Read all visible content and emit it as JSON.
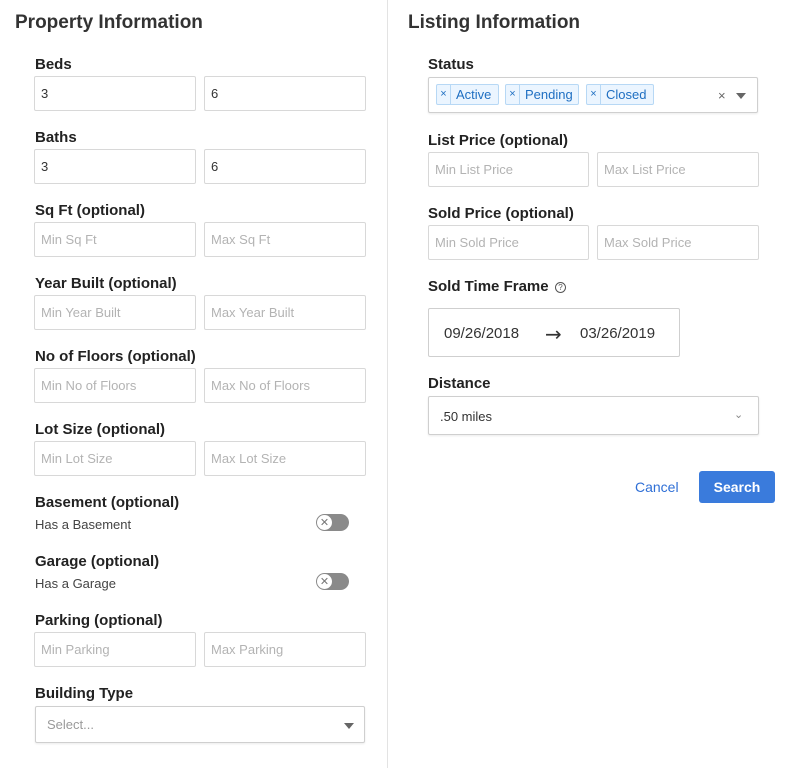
{
  "property": {
    "title": "Property Information",
    "beds": {
      "label": "Beds",
      "min_value": "3",
      "max_value": "6"
    },
    "baths": {
      "label": "Baths",
      "min_value": "3",
      "max_value": "6"
    },
    "sqft": {
      "label": "Sq Ft (optional)",
      "min_placeholder": "Min Sq Ft",
      "max_placeholder": "Max Sq Ft"
    },
    "year_built": {
      "label": "Year Built (optional)",
      "min_placeholder": "Min Year Built",
      "max_placeholder": "Max Year Built"
    },
    "floors": {
      "label": "No of Floors (optional)",
      "min_placeholder": "Min No of Floors",
      "max_placeholder": "Max No of Floors"
    },
    "lot_size": {
      "label": "Lot Size (optional)",
      "min_placeholder": "Min Lot Size",
      "max_placeholder": "Max Lot Size"
    },
    "basement": {
      "label": "Basement (optional)",
      "toggle_label": "Has a Basement"
    },
    "garage": {
      "label": "Garage (optional)",
      "toggle_label": "Has a Garage"
    },
    "parking": {
      "label": "Parking (optional)",
      "min_placeholder": "Min Parking",
      "max_placeholder": "Max Parking"
    },
    "building_type": {
      "label": "Building Type",
      "placeholder": "Select..."
    }
  },
  "listing": {
    "title": "Listing Information",
    "status": {
      "label": "Status",
      "tags": [
        "Active",
        "Pending",
        "Closed"
      ],
      "remove_glyph": "×",
      "clear_glyph": "×"
    },
    "list_price": {
      "label": "List Price (optional)",
      "min_placeholder": "Min List Price",
      "max_placeholder": "Max List Price"
    },
    "sold_price": {
      "label": "Sold Price (optional)",
      "min_placeholder": "Min Sold Price",
      "max_placeholder": "Max Sold Price"
    },
    "sold_time_frame": {
      "label": "Sold Time Frame",
      "start": "09/26/2018",
      "end": "03/26/2019"
    },
    "distance": {
      "label": "Distance",
      "value": ".50 miles"
    }
  },
  "actions": {
    "cancel_label": "Cancel",
    "search_label": "Search"
  },
  "colors": {
    "primary": "#3a7bdc",
    "tag_bg": "#ebf5ff",
    "tag_text": "#1f6fc2",
    "toggle_off": "#8a8a8a"
  }
}
